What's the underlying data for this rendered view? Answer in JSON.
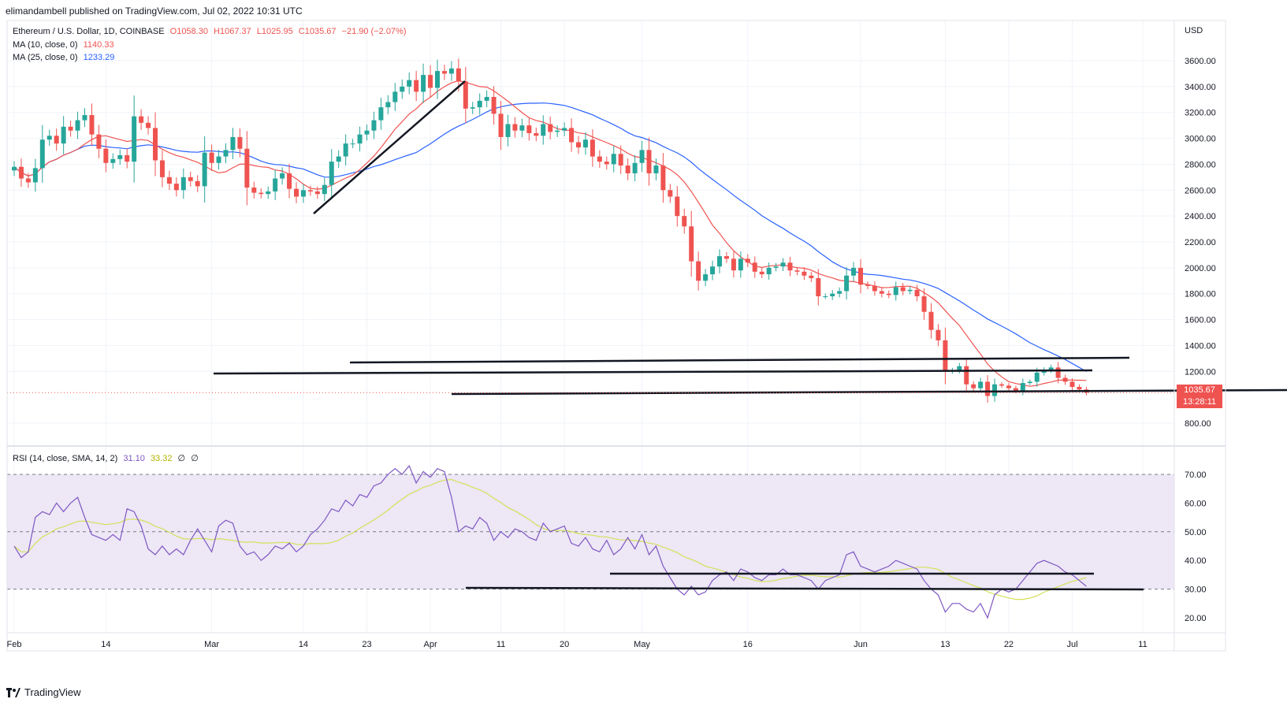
{
  "publisher": "elimandambell published on TradingView.com, Jul 02, 2022 10:31 UTC",
  "branding": {
    "logo_text": "TradingView",
    "icon": "tradingview-logo-icon"
  },
  "legend": {
    "symbol": "Ethereum / U.S. Dollar, 1D, COINBASE",
    "ohlc": {
      "O": "O1058.30",
      "H": "H1067.37",
      "L": "L1025.95",
      "C": "C1035.67",
      "change": "−21.90 (−2.07%)"
    },
    "ma10": {
      "label": "MA (10, close, 0)",
      "value": "1140.33"
    },
    "ma25": {
      "label": "MA (25, close, 0)",
      "value": "1233.29"
    },
    "rsi": {
      "label": "RSI (14, close, SMA, 14, 2)",
      "value": "31.10",
      "sma": "33.32",
      "extra1": "∅",
      "extra2": "∅"
    }
  },
  "price_badge": {
    "price": "1035.67",
    "countdown": "13:28:11"
  },
  "colors": {
    "up": "#26a69a",
    "down": "#ef5350",
    "ma10": "#ef5350",
    "ma25": "#2962ff",
    "rsi": "#7e57c2",
    "rsi_sma": "#d4e157",
    "rsi_band": "#ede7f6"
  },
  "chart_data": [
    {
      "type": "candlestick",
      "currency": "USD",
      "y_ticks": [
        "3600.00",
        "3400.00",
        "3200.00",
        "3000.00",
        "2800.00",
        "2600.00",
        "2400.00",
        "2200.00",
        "2000.00",
        "1800.00",
        "1600.00",
        "1400.00",
        "1200.00",
        "800.00"
      ],
      "ylim": [
        640,
        3900
      ],
      "x_ticks": [
        {
          "label": "Feb",
          "day": 0
        },
        {
          "label": "14",
          "day": 13
        },
        {
          "label": "Mar",
          "day": 28
        },
        {
          "label": "14",
          "day": 41
        },
        {
          "label": "23",
          "day": 50
        },
        {
          "label": "Apr",
          "day": 59
        },
        {
          "label": "11",
          "day": 69
        },
        {
          "label": "20",
          "day": 78
        },
        {
          "label": "May",
          "day": 89
        },
        {
          "label": "16",
          "day": 104
        },
        {
          "label": "Jun",
          "day": 120
        },
        {
          "label": "13",
          "day": 132
        },
        {
          "label": "22",
          "day": 141
        },
        {
          "label": "Jul",
          "day": 150
        },
        {
          "label": "11",
          "day": 160
        }
      ],
      "close": [
        2780,
        2690,
        2660,
        2770,
        2990,
        3020,
        2960,
        3090,
        3060,
        3140,
        3180,
        3030,
        2920,
        2810,
        2840,
        2870,
        2820,
        3170,
        3120,
        3080,
        2830,
        2700,
        2650,
        2600,
        2700,
        2670,
        2630,
        2890,
        2810,
        2860,
        2910,
        3010,
        2920,
        2620,
        2580,
        2570,
        2590,
        2690,
        2730,
        2610,
        2550,
        2600,
        2590,
        2570,
        2640,
        2820,
        2860,
        2960,
        2960,
        3030,
        3060,
        3140,
        3240,
        3280,
        3360,
        3400,
        3450,
        3360,
        3490,
        3390,
        3520,
        3500,
        3540,
        3440,
        3230,
        3240,
        3290,
        3320,
        3190,
        3010,
        3110,
        3060,
        3100,
        3040,
        3020,
        3110,
        3050,
        3060,
        3080,
        2970,
        2930,
        2990,
        2860,
        2820,
        2800,
        2880,
        2790,
        2730,
        2810,
        2910,
        2730,
        2790,
        2600,
        2550,
        2400,
        2320,
        2050,
        1900,
        1950,
        2010,
        2090,
        2070,
        1980,
        2070,
        2040,
        1970,
        1950,
        2000,
        2010,
        2040,
        1980,
        1970,
        1940,
        1920,
        1780,
        1780,
        1800,
        1820,
        1940,
        2000,
        1870,
        1860,
        1820,
        1800,
        1790,
        1850,
        1820,
        1830,
        1780,
        1660,
        1520,
        1440,
        1200,
        1210,
        1240,
        1100,
        1070,
        1120,
        1010,
        1100,
        1090,
        1070,
        1050,
        1110,
        1120,
        1190,
        1210,
        1230,
        1150,
        1120,
        1080,
        1060,
        1036
      ],
      "ma_periods": [
        10,
        25
      ]
    },
    {
      "type": "line",
      "name": "RSI (14, close, SMA, 14, 2)",
      "y_ticks": [
        "70.00",
        "60.00",
        "50.00",
        "40.00",
        "30.00",
        "20.00"
      ],
      "ylim": [
        15,
        75
      ],
      "band": [
        30,
        70
      ],
      "values": [
        45,
        41,
        43,
        55,
        57,
        56,
        60,
        57,
        60,
        62,
        55,
        49,
        48,
        47,
        49,
        47,
        58,
        57,
        52,
        44,
        42,
        45,
        42,
        44,
        42,
        47,
        51,
        47,
        43,
        52,
        54,
        53,
        45,
        42,
        43,
        40,
        42,
        45,
        44,
        46,
        43,
        45,
        49,
        51,
        54,
        58,
        57,
        61,
        59,
        63,
        62,
        66,
        67,
        70,
        72,
        70,
        73,
        67,
        71,
        69,
        72,
        71,
        62,
        50,
        52,
        51,
        55,
        53,
        47,
        50,
        48,
        51,
        50,
        48,
        47,
        53,
        50,
        51,
        52,
        46,
        45,
        48,
        44,
        43,
        47,
        42,
        44,
        48,
        44,
        49,
        42,
        45,
        38,
        34,
        30,
        28,
        31,
        28,
        29,
        33,
        35,
        36,
        33,
        37,
        36,
        34,
        33,
        35,
        35,
        37,
        35,
        35,
        34,
        33,
        30,
        33,
        34,
        35,
        42,
        43,
        38,
        37,
        36,
        37,
        38,
        40,
        39,
        38,
        37,
        33,
        30,
        28,
        22,
        25,
        25,
        23,
        22,
        25,
        20,
        28,
        30,
        29,
        30,
        33,
        36,
        39,
        40,
        39,
        38,
        36,
        35,
        33,
        31
      ]
    }
  ]
}
